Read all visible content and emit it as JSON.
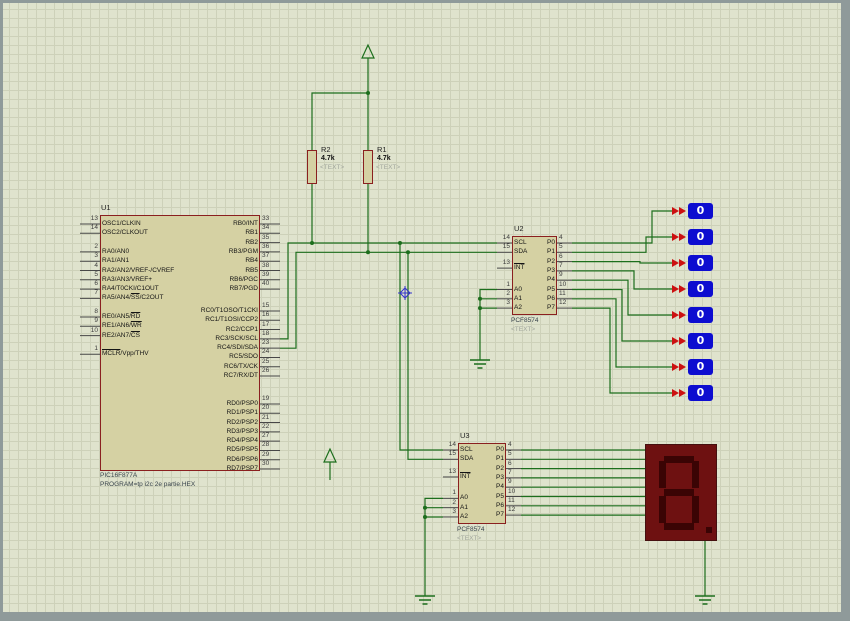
{
  "colors": {
    "wire": "#1c6e1c",
    "pin": "#474747",
    "outline": "#8a1f1f",
    "fill": "#d5d1a3",
    "probe_blue": "#0d0dd0",
    "probe_text": "#ffffff",
    "led_red": "#cc1111",
    "display_body": "#6e1111",
    "display_segment": "#3a0404",
    "marker_blue": "#3434cc",
    "gray_text": "#a0a59c"
  },
  "u1": {
    "ref": "U1",
    "part": "PIC16F877A",
    "program": "PROGRAM=tp i2c 2e partie.HEX",
    "left_groups": [
      [
        {
          "num": "13",
          "name": "OSC1/CLKIN"
        },
        {
          "num": "14",
          "name": "OSC2/CLKOUT"
        }
      ],
      [
        {
          "num": "2",
          "name": "RA0/AN0"
        },
        {
          "num": "3",
          "name": "RA1/AN1"
        },
        {
          "num": "4",
          "name": "RA2/AN2/VREF-/CVREF"
        },
        {
          "num": "5",
          "name": "RA3/AN3/VREF+"
        },
        {
          "num": "6",
          "name": "RA4/T0CKI/C1OUT"
        },
        {
          "num": "7",
          "name": "RA5/AN4/SS/C2OUT",
          "ol": "SS"
        }
      ],
      [
        {
          "num": "8",
          "name": "RE0/AN5/RD",
          "ol": "RD"
        },
        {
          "num": "9",
          "name": "RE1/AN6/WR",
          "ol": "WR"
        },
        {
          "num": "10",
          "name": "RE2/AN7/CS",
          "ol": "CS"
        }
      ],
      [
        {
          "num": "1",
          "name": "MCLR/Vpp/THV",
          "ol": "MCLR"
        }
      ]
    ],
    "right_groups": [
      [
        {
          "num": "33",
          "name": "RB0/INT"
        },
        {
          "num": "34",
          "name": "RB1"
        },
        {
          "num": "35",
          "name": "RB2"
        },
        {
          "num": "36",
          "name": "RB3/PGM"
        },
        {
          "num": "37",
          "name": "RB4"
        },
        {
          "num": "38",
          "name": "RB5"
        },
        {
          "num": "39",
          "name": "RB6/PGC"
        },
        {
          "num": "40",
          "name": "RB7/PGD"
        }
      ],
      [
        {
          "num": "15",
          "name": "RC0/T1OSO/T1CKI"
        },
        {
          "num": "16",
          "name": "RC1/T1OSI/CCP2"
        },
        {
          "num": "17",
          "name": "RC2/CCP1"
        },
        {
          "num": "18",
          "name": "RC3/SCK/SCL"
        },
        {
          "num": "23",
          "name": "RC4/SDI/SDA"
        },
        {
          "num": "24",
          "name": "RC5/SDO"
        },
        {
          "num": "25",
          "name": "RC6/TX/CK"
        },
        {
          "num": "26",
          "name": "RC7/RX/DT"
        }
      ],
      [
        {
          "num": "19",
          "name": "RD0/PSP0"
        },
        {
          "num": "20",
          "name": "RD1/PSP1"
        },
        {
          "num": "21",
          "name": "RD2/PSP2"
        },
        {
          "num": "22",
          "name": "RD3/PSP3"
        },
        {
          "num": "27",
          "name": "RD4/PSP4"
        },
        {
          "num": "28",
          "name": "RD5/PSP5"
        },
        {
          "num": "29",
          "name": "RD6/PSP6"
        },
        {
          "num": "30",
          "name": "RD7/PSP7"
        }
      ]
    ]
  },
  "u2": {
    "ref": "U2",
    "part": "PCF8574",
    "text": "<TEXT>",
    "left_groups": [
      [
        {
          "num": "14",
          "name": "SCL"
        },
        {
          "num": "15",
          "name": "SDA"
        }
      ],
      [
        {
          "num": "13",
          "name": "INT",
          "ol": "INT"
        }
      ],
      [
        {
          "num": "1",
          "name": "A0"
        },
        {
          "num": "2",
          "name": "A1"
        },
        {
          "num": "3",
          "name": "A2"
        }
      ]
    ],
    "right_groups": [
      [
        {
          "num": "4",
          "name": "P0"
        },
        {
          "num": "5",
          "name": "P1"
        },
        {
          "num": "6",
          "name": "P2"
        },
        {
          "num": "7",
          "name": "P3"
        },
        {
          "num": "9",
          "name": "P4"
        },
        {
          "num": "10",
          "name": "P5"
        },
        {
          "num": "11",
          "name": "P6"
        },
        {
          "num": "12",
          "name": "P7"
        }
      ]
    ]
  },
  "u3": {
    "ref": "U3",
    "part": "PCF8574",
    "text": "<TEXT>",
    "left_groups": [
      [
        {
          "num": "14",
          "name": "SCL"
        },
        {
          "num": "15",
          "name": "SDA"
        }
      ],
      [
        {
          "num": "13",
          "name": "INT",
          "ol": "INT"
        }
      ],
      [
        {
          "num": "1",
          "name": "A0"
        },
        {
          "num": "2",
          "name": "A1"
        },
        {
          "num": "3",
          "name": "A2"
        }
      ]
    ],
    "right_groups": [
      [
        {
          "num": "4",
          "name": "P0"
        },
        {
          "num": "5",
          "name": "P1"
        },
        {
          "num": "6",
          "name": "P2"
        },
        {
          "num": "7",
          "name": "P3"
        },
        {
          "num": "9",
          "name": "P4"
        },
        {
          "num": "10",
          "name": "P5"
        },
        {
          "num": "11",
          "name": "P6"
        },
        {
          "num": "12",
          "name": "P7"
        }
      ]
    ]
  },
  "r1": {
    "ref": "R1",
    "value": "4.7k",
    "text": "<TEXT>"
  },
  "r2": {
    "ref": "R2",
    "value": "4.7k",
    "text": "<TEXT>"
  },
  "probes": {
    "values": [
      "0",
      "0",
      "0",
      "0",
      "0",
      "0",
      "0",
      "0"
    ]
  },
  "display": {
    "value": "8",
    "segments_on": [
      "A",
      "B",
      "C",
      "D",
      "E",
      "F",
      "G",
      "DP"
    ]
  }
}
